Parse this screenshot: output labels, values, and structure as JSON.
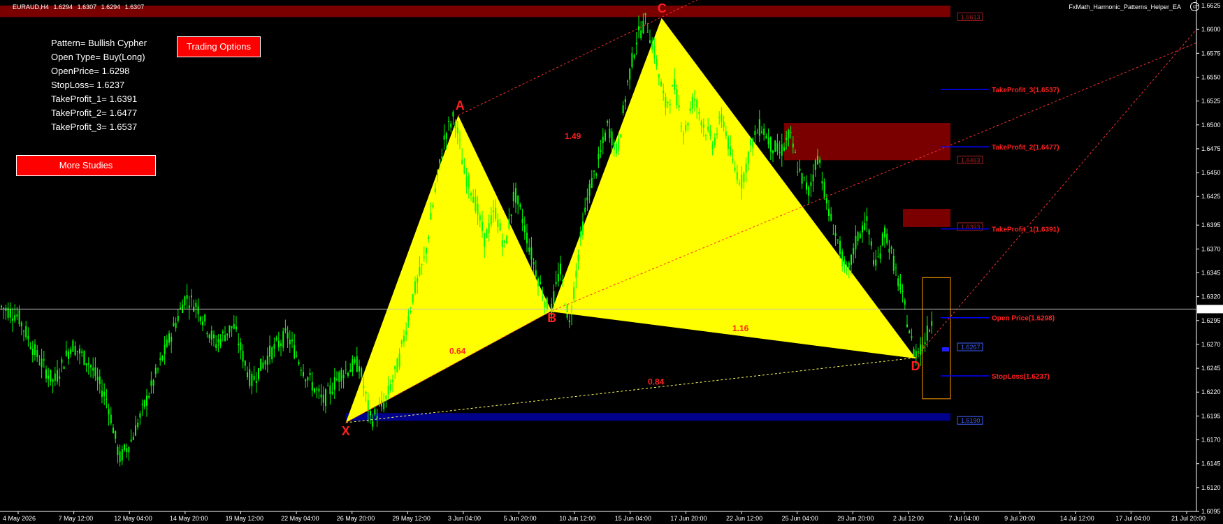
{
  "header": {
    "symbol": "EURAUD,H4",
    "ohlc": [
      "1.6294",
      "1.6307",
      "1.6294",
      "1.6307"
    ],
    "ea_name": "FxMath_Harmonic_Patterns_Helper_EA",
    "smiley_icon": "smiley-icon"
  },
  "info_panel": {
    "pattern": "Pattern= Bullish Cypher",
    "open_type": "Open Type= Buy(Long)",
    "open_price": "OpenPrice= 1.6298",
    "stop_loss": "StopLoss= 1.6237",
    "tp1": "TakeProfit_1= 1.6391",
    "tp2": "TakeProfit_2= 1.6477",
    "tp3": "TakeProfit_3= 1.6537"
  },
  "buttons": {
    "trading_options": "Trading Options",
    "more_studies": "More Studies"
  },
  "chart_data": {
    "type": "candlestick",
    "symbol": "EURAUD",
    "timeframe": "H4",
    "ylim": [
      1.6095,
      1.6625
    ],
    "price_ticks": [
      "1.6625",
      "1.6600",
      "1.6575",
      "1.6550",
      "1.6525",
      "1.6500",
      "1.6475",
      "1.6450",
      "1.6425",
      "1.6395",
      "1.6370",
      "1.6345",
      "1.6320",
      "1.6295",
      "1.6270",
      "1.6245",
      "1.6220",
      "1.6195",
      "1.6170",
      "1.6145",
      "1.6120",
      "1.6095"
    ],
    "time_ticks": [
      "4 May 2026",
      "7 May 12:00",
      "12 May 04:00",
      "14 May 20:00",
      "19 May 12:00",
      "22 May 04:00",
      "26 May 20:00",
      "29 May 12:00",
      "3 Jun 04:00",
      "5 Jun 20:00",
      "10 Jun 12:00",
      "15 Jun 04:00",
      "17 Jun 20:00",
      "22 Jun 12:00",
      "25 Jun 04:00",
      "29 Jun 20:00",
      "2 Jul 12:00",
      "7 Jul 04:00",
      "9 Jul 20:00",
      "14 Jul 12:00",
      "17 Jul 04:00",
      "21 Jul 20:00"
    ],
    "current_price": "1.6307",
    "price_path": [
      [
        0,
        1.631
      ],
      [
        0.015,
        1.63
      ],
      [
        0.03,
        1.626
      ],
      [
        0.045,
        1.623
      ],
      [
        0.06,
        1.627
      ],
      [
        0.075,
        1.625
      ],
      [
        0.09,
        1.621
      ],
      [
        0.1,
        1.615
      ],
      [
        0.11,
        1.617
      ],
      [
        0.125,
        1.622
      ],
      [
        0.14,
        1.627
      ],
      [
        0.155,
        1.632
      ],
      [
        0.165,
        1.631
      ],
      [
        0.18,
        1.627
      ],
      [
        0.195,
        1.629
      ],
      [
        0.21,
        1.623
      ],
      [
        0.225,
        1.626
      ],
      [
        0.24,
        1.628
      ],
      [
        0.255,
        1.624
      ],
      [
        0.27,
        1.621
      ],
      [
        0.285,
        1.624
      ],
      [
        0.3,
        1.625
      ],
      [
        0.31,
        1.619
      ],
      [
        0.322,
        1.621
      ],
      [
        0.333,
        1.625
      ],
      [
        0.345,
        1.632
      ],
      [
        0.355,
        1.636
      ],
      [
        0.365,
        1.644
      ],
      [
        0.372,
        1.649
      ],
      [
        0.38,
        1.651
      ],
      [
        0.388,
        1.645
      ],
      [
        0.395,
        1.643
      ],
      [
        0.405,
        1.638
      ],
      [
        0.414,
        1.641
      ],
      [
        0.422,
        1.637
      ],
      [
        0.43,
        1.643
      ],
      [
        0.437,
        1.64
      ],
      [
        0.445,
        1.636
      ],
      [
        0.452,
        1.633
      ],
      [
        0.46,
        1.63
      ],
      [
        0.468,
        1.635
      ],
      [
        0.476,
        1.629
      ],
      [
        0.484,
        1.637
      ],
      [
        0.492,
        1.643
      ],
      [
        0.5,
        1.646
      ],
      [
        0.508,
        1.65
      ],
      [
        0.516,
        1.647
      ],
      [
        0.524,
        1.654
      ],
      [
        0.532,
        1.659
      ],
      [
        0.54,
        1.661
      ],
      [
        0.548,
        1.657
      ],
      [
        0.556,
        1.652
      ],
      [
        0.564,
        1.654
      ],
      [
        0.572,
        1.649
      ],
      [
        0.58,
        1.653
      ],
      [
        0.588,
        1.65
      ],
      [
        0.596,
        1.648
      ],
      [
        0.604,
        1.651
      ],
      [
        0.612,
        1.646
      ],
      [
        0.62,
        1.644
      ],
      [
        0.628,
        1.648
      ],
      [
        0.636,
        1.65
      ],
      [
        0.644,
        1.648
      ],
      [
        0.652,
        1.647
      ],
      [
        0.66,
        1.649
      ],
      [
        0.668,
        1.645
      ],
      [
        0.676,
        1.643
      ],
      [
        0.684,
        1.647
      ],
      [
        0.692,
        1.641
      ],
      [
        0.7,
        1.638
      ],
      [
        0.708,
        1.634
      ],
      [
        0.716,
        1.638
      ],
      [
        0.724,
        1.64
      ],
      [
        0.732,
        1.635
      ],
      [
        0.74,
        1.639
      ],
      [
        0.748,
        1.635
      ],
      [
        0.756,
        1.631
      ],
      [
        0.764,
        1.626
      ],
      [
        0.772,
        1.627
      ],
      [
        0.78,
        1.63
      ]
    ],
    "pattern": {
      "name": "Bullish Cypher",
      "points": [
        {
          "label": "X",
          "price": 1.6188
        },
        {
          "label": "A",
          "price": 1.651
        },
        {
          "label": "B",
          "price": 1.6305
        },
        {
          "label": "C",
          "price": 1.6612
        },
        {
          "label": "D",
          "price": 1.6256
        }
      ],
      "ratios": [
        "0.64",
        "1.49",
        "1.16",
        "0.84"
      ]
    },
    "levels": {
      "take_profit_3": {
        "label": "TakeProfit_3(1.6537)",
        "price": 1.6537
      },
      "take_profit_2": {
        "label": "TakeProfit_2(1.6477)",
        "price": 1.6477
      },
      "take_profit_1": {
        "label": "TakeProfit_1(1.6391)",
        "price": 1.6391
      },
      "open_price": {
        "label": "Open Price(1.6298)",
        "price": 1.6298
      },
      "stop_loss": {
        "label": "StopLoss(1.6237)",
        "price": 1.6237
      }
    },
    "zones": {
      "top": {
        "label": "1.6613"
      },
      "mid": {
        "label": "1.6463"
      },
      "low": {
        "label": "1.6393"
      },
      "blue_zone": {
        "label": "1.6190"
      },
      "d_box": {
        "label": "1.6267"
      }
    },
    "colors": {
      "background": "#000000",
      "candles": "#00ff00",
      "pattern_fill": "#ffff00",
      "labels": "#ff2020",
      "level_line": "#0000ff",
      "zone_red": "#7a0000",
      "zone_blue": "#00008b",
      "d_box": "#ff9900"
    }
  }
}
